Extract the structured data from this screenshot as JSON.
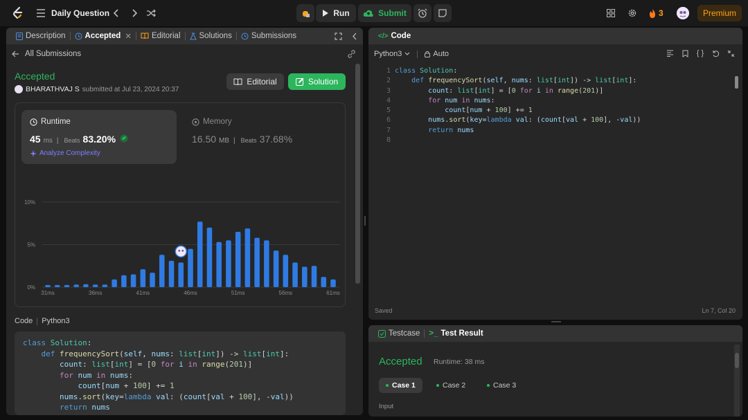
{
  "topbar": {
    "title": "Daily Question",
    "run_label": "Run",
    "submit_label": "Submit",
    "streak": "3",
    "premium_label": "Premium"
  },
  "tabs": {
    "description": "Description",
    "accepted": "Accepted",
    "editorial": "Editorial",
    "solutions": "Solutions",
    "submissions": "Submissions"
  },
  "submission": {
    "all_submissions": "All Submissions",
    "status": "Accepted",
    "user": "BHARATHVAJ S",
    "submitted_text": "submitted at Jul 23, 2024 20:37",
    "editorial_btn": "Editorial",
    "solution_btn": "Solution",
    "runtime_label": "Runtime",
    "runtime_value": "45",
    "runtime_unit": "ms",
    "beats_label": "Beats",
    "runtime_beats": "83.20%",
    "analyze_label": "Analyze Complexity",
    "memory_label": "Memory",
    "memory_value": "16.50",
    "memory_unit": "MB",
    "memory_beats": "37.68%",
    "code_label": "Code",
    "lang_label": "Python3"
  },
  "chart_data": {
    "type": "bar",
    "x_ticks": [
      "31ms",
      "36ms",
      "41ms",
      "46ms",
      "51ms",
      "56ms",
      "61ms"
    ],
    "y_ticks": [
      "10%",
      "5%",
      "0%"
    ],
    "ylim": [
      0,
      10
    ],
    "bars_x": [
      31,
      32,
      33,
      34,
      35,
      36,
      37,
      38,
      39,
      40,
      41,
      42,
      43,
      44,
      45,
      46,
      47,
      48,
      49,
      50,
      51,
      52,
      53,
      54,
      55,
      56,
      57,
      58,
      59,
      60,
      61
    ],
    "bars_y": [
      0.25,
      0.25,
      0.25,
      0.3,
      0.35,
      0.3,
      0.3,
      0.9,
      1.4,
      1.5,
      2.1,
      1.7,
      3.8,
      3.1,
      2.9,
      4.5,
      7.7,
      7.0,
      5.3,
      5.5,
      6.5,
      6.9,
      5.8,
      5.5,
      4.3,
      3.8,
      2.9,
      2.4,
      2.5,
      1.2,
      0.9
    ],
    "highlight_x": 45,
    "highlight_y": 4.2,
    "bar_color": "#2f7be3"
  },
  "code_preview": [
    "class Solution:",
    "    def frequencySort(self, nums: list[int]) -> list[int]:",
    "        count: list[int] = [0 for i in range(201)]",
    "        for num in nums:",
    "            count[num + 100] += 1",
    "        nums.sort(key=lambda val: (count[val + 100], -val))",
    "        return nums"
  ],
  "editor": {
    "title": "Code",
    "language": "Python3",
    "mode": "Auto",
    "line_numbers": [
      "1",
      "2",
      "3",
      "4",
      "5",
      "6",
      "7",
      "8"
    ],
    "status_saved": "Saved",
    "cursor_pos": "Ln 7, Col 20"
  },
  "result": {
    "tab_testcase": "Testcase",
    "tab_result": "Test Result",
    "status": "Accepted",
    "runtime": "Runtime: 38 ms",
    "cases": [
      "Case 1",
      "Case 2",
      "Case 3"
    ],
    "input_label": "Input"
  },
  "colors": {
    "accent_green": "#2db55d",
    "accent_orange": "#ffa116",
    "bar_blue": "#2f7be3"
  }
}
